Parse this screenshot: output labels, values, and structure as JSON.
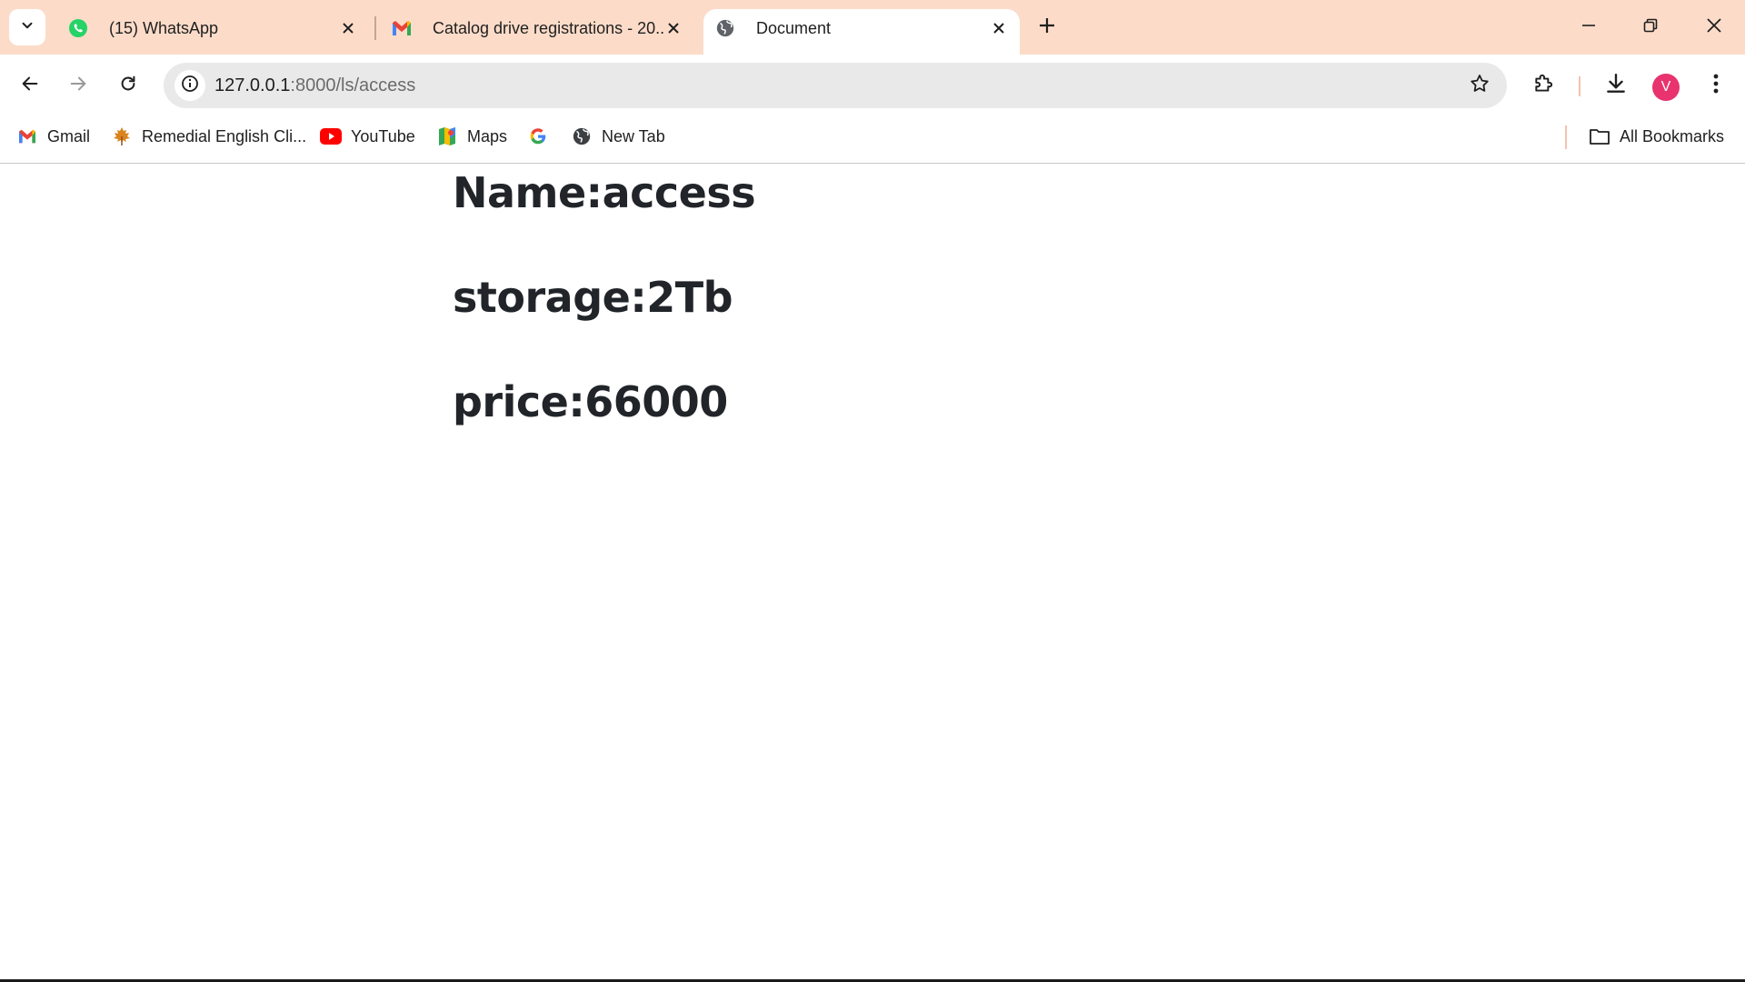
{
  "browser": {
    "tabs": [
      {
        "title": "(15) WhatsApp",
        "icon": "whatsapp-icon",
        "active": false
      },
      {
        "title": "Catalog drive registrations - 20...",
        "icon": "gmail-icon",
        "active": false
      },
      {
        "title": "Document",
        "icon": "globe-icon",
        "active": true
      }
    ],
    "address": {
      "host": "127.0.0.1",
      "path": ":8000/ls/access"
    },
    "profile_initial": "V",
    "accent_color": "#fcdcc9",
    "bookmarks": [
      {
        "label": "Gmail",
        "icon": "gmail-icon"
      },
      {
        "label": "Remedial English Cli...",
        "icon": "maple-leaf-icon"
      },
      {
        "label": "YouTube",
        "icon": "youtube-icon"
      },
      {
        "label": "Maps",
        "icon": "maps-icon"
      },
      {
        "label": "",
        "icon": "google-icon"
      },
      {
        "label": "New Tab",
        "icon": "globe-icon"
      }
    ],
    "all_bookmarks_label": "All Bookmarks"
  },
  "page": {
    "name_line": "Name:access",
    "storage_line": "storage:2Tb",
    "price_line": "price:66000"
  }
}
